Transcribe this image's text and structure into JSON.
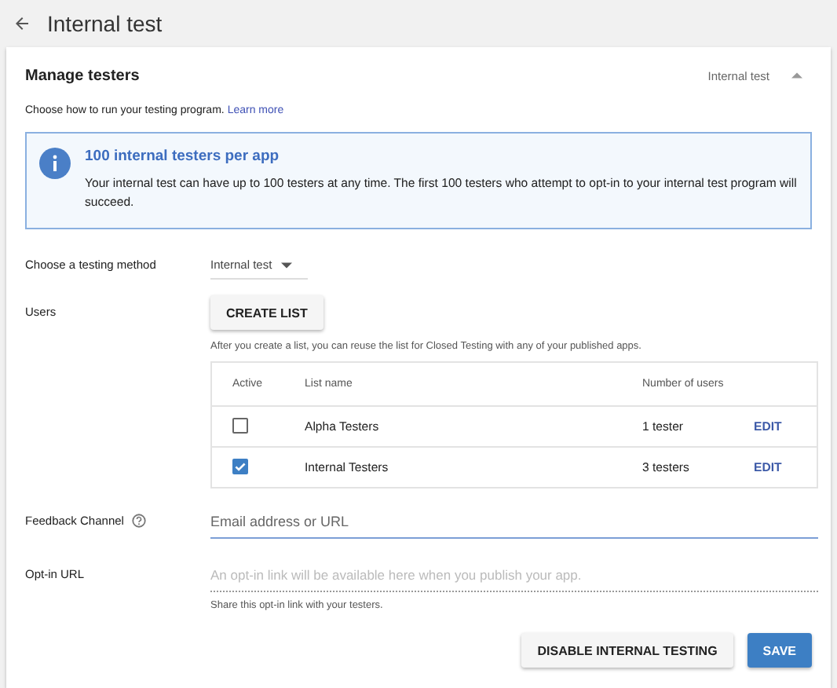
{
  "header": {
    "title": "Internal test"
  },
  "section": {
    "title": "Manage testers",
    "summary": "Internal test",
    "expanded": true
  },
  "intro": {
    "text": "Choose how to run your testing program.",
    "link": "Learn more"
  },
  "notice": {
    "title": "100 internal testers per app",
    "body": "Your internal test can have up to 100 testers at any time. The first 100 testers who attempt to opt-in to your internal test program will succeed."
  },
  "method": {
    "label": "Choose a testing method",
    "value": "Internal test"
  },
  "users": {
    "label": "Users",
    "button": "CREATE LIST",
    "hint": "After you create a list, you can reuse the list for Closed Testing with any of your published apps.",
    "columns": [
      "Active",
      "List name",
      "Number of users"
    ],
    "rows": [
      {
        "checked": false,
        "name": "Alpha Testers",
        "count": "1 tester",
        "action": "EDIT"
      },
      {
        "checked": true,
        "name": "Internal Testers",
        "count": "3 testers",
        "action": "EDIT"
      }
    ]
  },
  "feedback": {
    "label": "Feedback Channel",
    "placeholder": "Email address or URL"
  },
  "optin": {
    "label": "Opt-in URL",
    "placeholder": "An opt-in link will be available here when you publish your app.",
    "hint": "Share this opt-in link with your testers."
  },
  "buttons": [
    {
      "kind": "secondary",
      "label": "DISABLE INTERNAL TESTING"
    },
    {
      "kind": "primary",
      "label": "SAVE"
    }
  ]
}
